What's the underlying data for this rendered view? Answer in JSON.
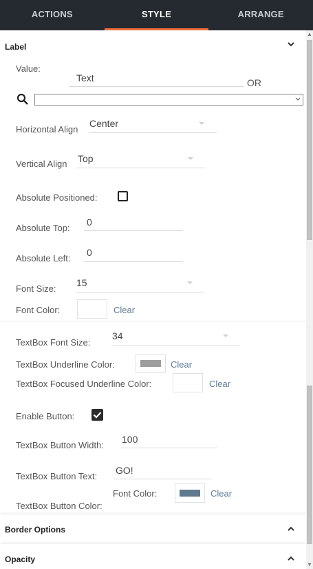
{
  "tabs": [
    {
      "label": "ACTIONS"
    },
    {
      "label": "STYLE"
    },
    {
      "label": "ARRANGE"
    }
  ],
  "active_tab": "STYLE",
  "accent_color": "#f06c3b",
  "label_section": {
    "title": "Label",
    "value_label": "Value:",
    "value_text": "Text",
    "or_text": "OR",
    "search_value": "",
    "horizontal_align_label": "Horizontal Align",
    "horizontal_align_value": "Center",
    "vertical_align_label": "Vertical Align",
    "vertical_align_value": "Top",
    "absolute_positioned_label": "Absolute Positioned:",
    "absolute_positioned_checked": false,
    "absolute_top_label": "Absolute Top:",
    "absolute_top_value": "0",
    "absolute_left_label": "Absolute Left:",
    "absolute_left_value": "0",
    "font_size_label": "Font Size:",
    "font_size_value": "15",
    "font_color_label": "Font Color:",
    "font_color_clear": "Clear"
  },
  "textbox": {
    "font_size_label": "TextBox Font Size:",
    "font_size_value": "34",
    "underline_color_label": "TextBox Underline Color:",
    "underline_color": "#9e9e9e",
    "underline_clear": "Clear",
    "focused_underline_label": "TextBox Focused Underline Color:",
    "focused_underline_clear": "Clear",
    "enable_button_label": "Enable Button:",
    "enable_button_checked": true,
    "button_width_label": "TextBox Button Width:",
    "button_width_value": "100",
    "button_text_label": "TextBox Button Text:",
    "button_text_value": "GO!",
    "button_color_label": "TextBox Button Color:",
    "font_color_label": "Font Color:",
    "button_font_color": "#5f7a8c",
    "font_color_clear": "Clear"
  },
  "border_options": {
    "title": "Border Options"
  },
  "opacity": {
    "title": "Opacity"
  }
}
